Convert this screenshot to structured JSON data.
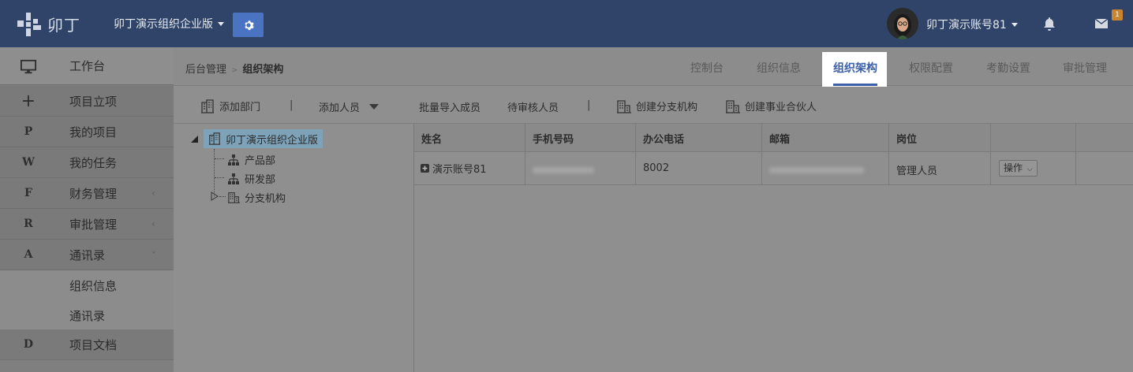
{
  "app": {
    "logo_text": "卯丁",
    "org_name": "卯丁演示组织企业版",
    "account_name": "卯丁演示账号81",
    "mail_badge": "1"
  },
  "sidebar": {
    "items": [
      {
        "icon": "monitor-icon",
        "glyph": "",
        "label": "工作台"
      },
      {
        "icon": "plus-icon",
        "glyph": "+",
        "label": "项目立项"
      },
      {
        "icon": "letter-p-icon",
        "glyph": "P",
        "label": "我的项目"
      },
      {
        "icon": "letter-w-icon",
        "glyph": "W",
        "label": "我的任务"
      },
      {
        "icon": "letter-f-icon",
        "glyph": "F",
        "label": "财务管理",
        "chevron": "‹"
      },
      {
        "icon": "letter-r-icon",
        "glyph": "R",
        "label": "审批管理",
        "chevron": "‹"
      },
      {
        "icon": "letter-a-icon",
        "glyph": "A",
        "label": "通讯录",
        "chevron": "ˇ"
      },
      {
        "label": "组织信息"
      },
      {
        "label": "通讯录"
      },
      {
        "icon": "letter-d-icon",
        "glyph": "D",
        "label": "项目文档"
      }
    ]
  },
  "breadcrumb": {
    "root": "后台管理",
    "separator": ">",
    "current": "组织架构"
  },
  "tabs": [
    {
      "label": "控制台"
    },
    {
      "label": "组织信息"
    },
    {
      "label": "组织架构",
      "active": true
    },
    {
      "label": "权限配置"
    },
    {
      "label": "考勤设置"
    },
    {
      "label": "审批管理"
    }
  ],
  "toolbar": {
    "add_dept": "添加部门",
    "sep": "|",
    "add_person": "添加人员",
    "batch_import": "批量导入成员",
    "pending_review": "待审核人员",
    "create_branch": "创建分支机构",
    "create_partner": "创建事业合伙人"
  },
  "tree": {
    "root": "卯丁演示组织企业版",
    "children": [
      {
        "label": "产品部"
      },
      {
        "label": "研发部"
      },
      {
        "label": "分支机构"
      }
    ]
  },
  "table": {
    "headers": [
      "姓名",
      "手机号码",
      "办公电话",
      "邮箱",
      "岗位",
      ""
    ],
    "rows": [
      {
        "name": "演示账号81",
        "office_phone": "8002",
        "position": "管理人员",
        "action": "操作"
      }
    ]
  },
  "colors": {
    "topbar": "#2f4468",
    "accent": "#3b5fa8",
    "gear_button": "#4a74c2",
    "badge": "#c8842e"
  }
}
